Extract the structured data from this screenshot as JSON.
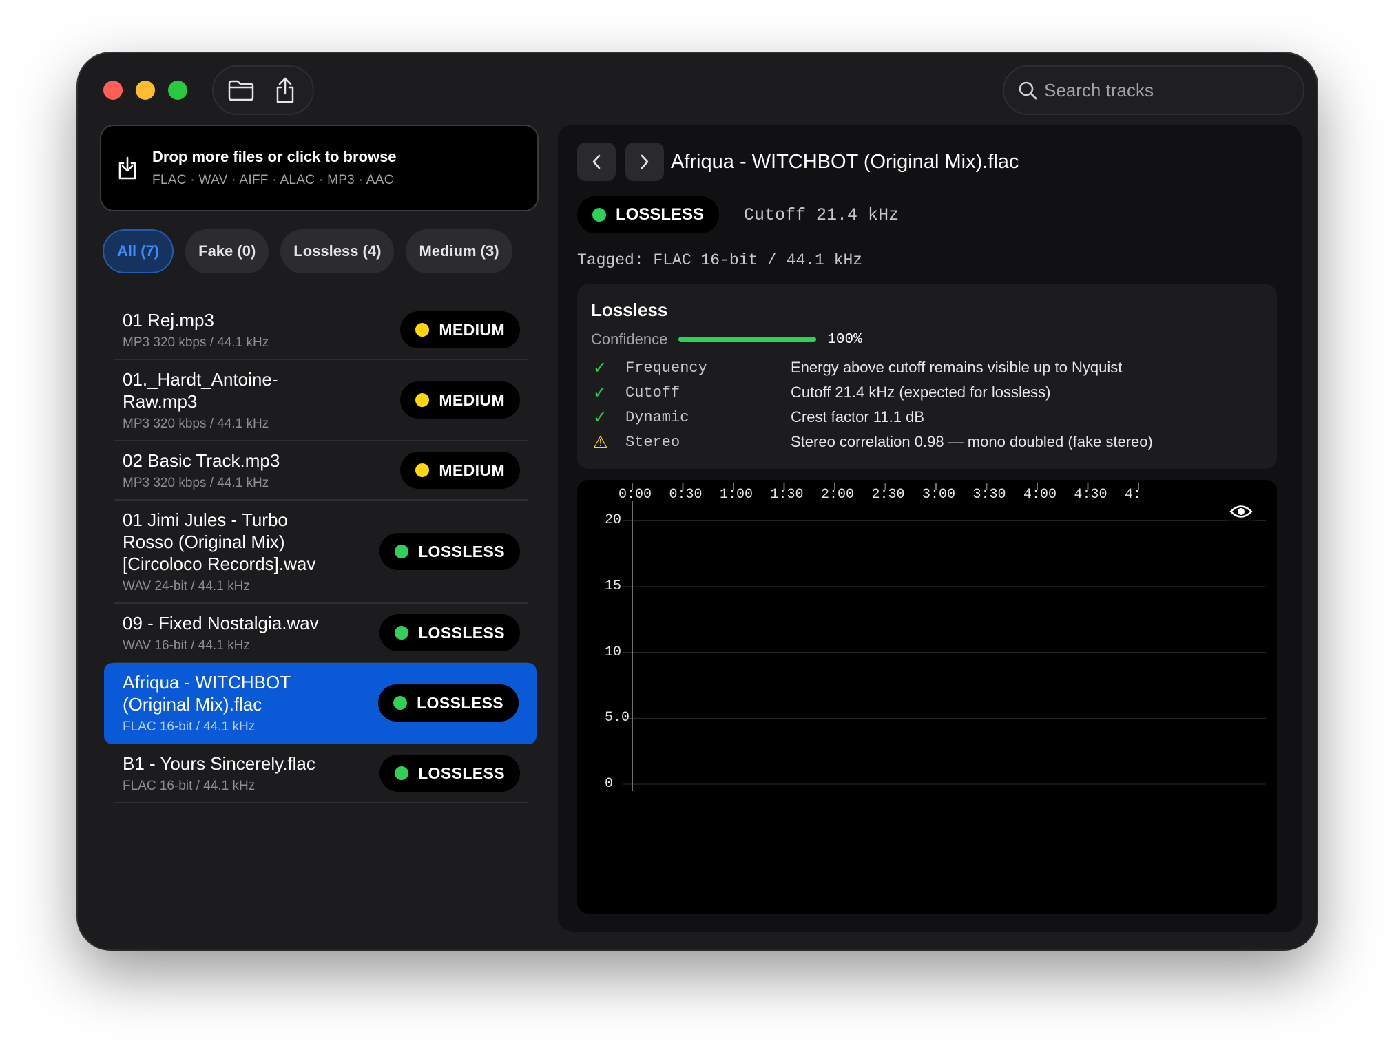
{
  "toolbar": {
    "open_icon": "folder-icon",
    "share_icon": "share-icon",
    "search_placeholder": "Search tracks"
  },
  "drop_zone": {
    "title": "Drop more files or click to browse",
    "formats": "FLAC · WAV · AIFF · ALAC · MP3 · AAC"
  },
  "filters": [
    {
      "label": "All (7)",
      "active": true
    },
    {
      "label": "Fake (0)",
      "active": false
    },
    {
      "label": "Lossless (4)",
      "active": false
    },
    {
      "label": "Medium (3)",
      "active": false
    }
  ],
  "tracks": [
    {
      "name": "01 Rej.mp3",
      "meta": "MP3 320 kbps / 44.1 kHz",
      "badge": "MEDIUM",
      "status": "medium"
    },
    {
      "name": "01._Hardt_Antoine-Raw.mp3",
      "meta": "MP3 320 kbps / 44.1 kHz",
      "badge": "MEDIUM",
      "status": "medium"
    },
    {
      "name": "02 Basic Track.mp3",
      "meta": "MP3 320 kbps / 44.1 kHz",
      "badge": "MEDIUM",
      "status": "medium"
    },
    {
      "name": "01 Jimi Jules - Turbo Rosso (Original Mix) [Circoloco Records].wav",
      "meta": "WAV 24-bit / 44.1 kHz",
      "badge": "LOSSLESS",
      "status": "lossless"
    },
    {
      "name": "09 - Fixed Nostalgia.wav",
      "meta": "WAV 16-bit / 44.1 kHz",
      "badge": "LOSSLESS",
      "status": "lossless"
    },
    {
      "name": "Afriqua - WITCHBOT (Original Mix).flac",
      "meta": "FLAC 16-bit / 44.1 kHz",
      "badge": "LOSSLESS",
      "status": "lossless",
      "selected": true
    },
    {
      "name": "B1 - Yours Sincerely.flac",
      "meta": "FLAC 16-bit / 44.1 kHz",
      "badge": "LOSSLESS",
      "status": "lossless"
    }
  ],
  "colors": {
    "medium": "#ffd60a",
    "lossless": "#30d158",
    "warning": "#ffd60a",
    "accent": "#0a59d6"
  },
  "detail": {
    "prev_icon": "chevron-left-icon",
    "next_icon": "chevron-right-icon",
    "title": "Afriqua - WITCHBOT (Original Mix).flac",
    "status": "LOSSLESS",
    "cutoff": "Cutoff 21.4 kHz",
    "tagged": "Tagged: FLAC 16-bit / 44.1 kHz",
    "verdict": "Lossless",
    "confidence_label": "Confidence",
    "confidence_value": 100,
    "confidence_text": "100%",
    "checks": [
      {
        "icon": "check-icon",
        "name": "Frequency",
        "desc": "Energy above cutoff remains visible up to Nyquist"
      },
      {
        "icon": "check-icon",
        "name": "Cutoff",
        "desc": "Cutoff 21.4 kHz (expected for lossless)"
      },
      {
        "icon": "check-icon",
        "name": "Dynamic",
        "desc": "Crest factor 11.1 dB"
      },
      {
        "icon": "warning-icon",
        "name": "Stereo",
        "desc": "Stereo correlation 0.98 — mono doubled (fake stereo)"
      }
    ],
    "spectrogram": {
      "time_ticks": [
        "0:00",
        "0:30",
        "1:00",
        "1:30",
        "2:00",
        "2:30",
        "3:00",
        "3:30",
        "4:00",
        "4:30",
        "4:"
      ],
      "freq_ticks": [
        "20",
        "15",
        "10",
        "5.0",
        "0"
      ],
      "freq_range_khz": [
        0,
        20
      ],
      "eye_icon": "eye-icon"
    }
  }
}
